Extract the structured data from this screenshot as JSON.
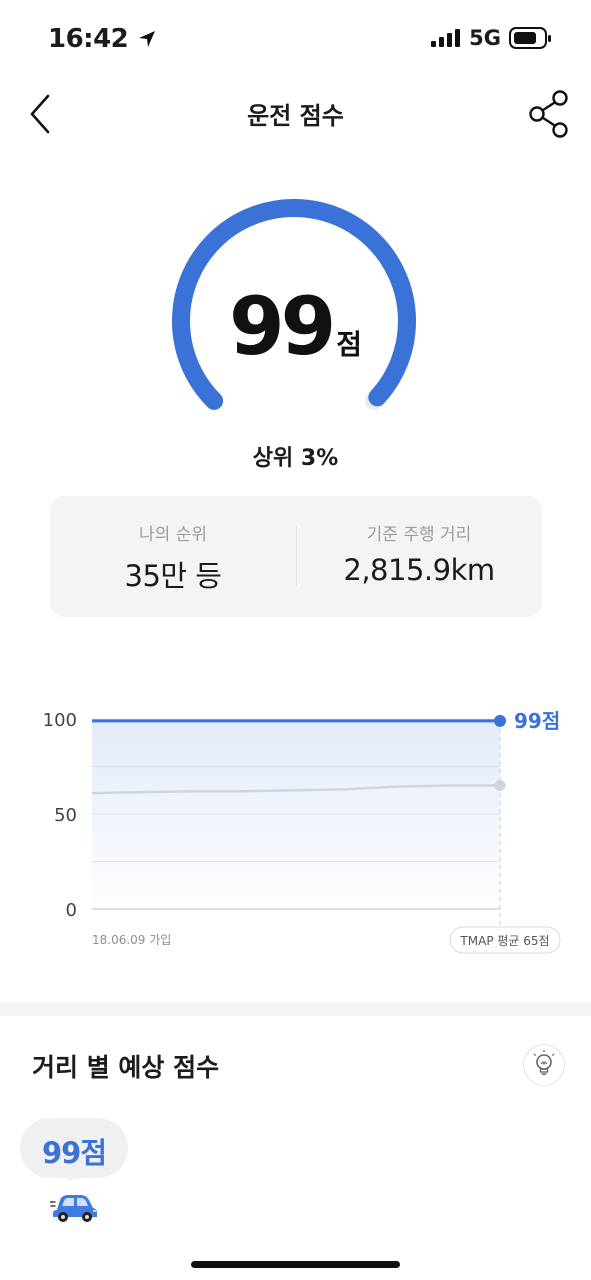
{
  "status": {
    "time": "16:42",
    "network": "5G"
  },
  "header": {
    "title": "운전 점수"
  },
  "gauge": {
    "score": "99",
    "unit": "점",
    "fill_fraction": 0.99,
    "accent": "#3a72d8"
  },
  "rank": {
    "text": "상위 3%"
  },
  "stats": [
    {
      "label": "나의 순위",
      "value": "35만 등"
    },
    {
      "label": "기준 주행 거리",
      "value": "2,815.9km"
    }
  ],
  "chart_data": {
    "type": "line",
    "ylim": [
      0,
      100
    ],
    "y_ticks": [
      "100",
      "50",
      "0"
    ],
    "x_start_label": "18.06.09 가입",
    "series": [
      {
        "values": [
          99,
          99,
          99,
          99,
          99,
          99,
          99,
          99,
          99
        ],
        "end_label": "99점",
        "color": "#3a72d8"
      },
      {
        "name": "TMAP 평균 65점",
        "values": [
          61,
          61.5,
          62,
          62,
          62.5,
          63,
          64.5,
          65,
          65
        ],
        "color": "#d2d4dc"
      }
    ]
  },
  "section": {
    "title": "거리 별 예상 점수"
  },
  "bubble": {
    "text": "99점"
  }
}
